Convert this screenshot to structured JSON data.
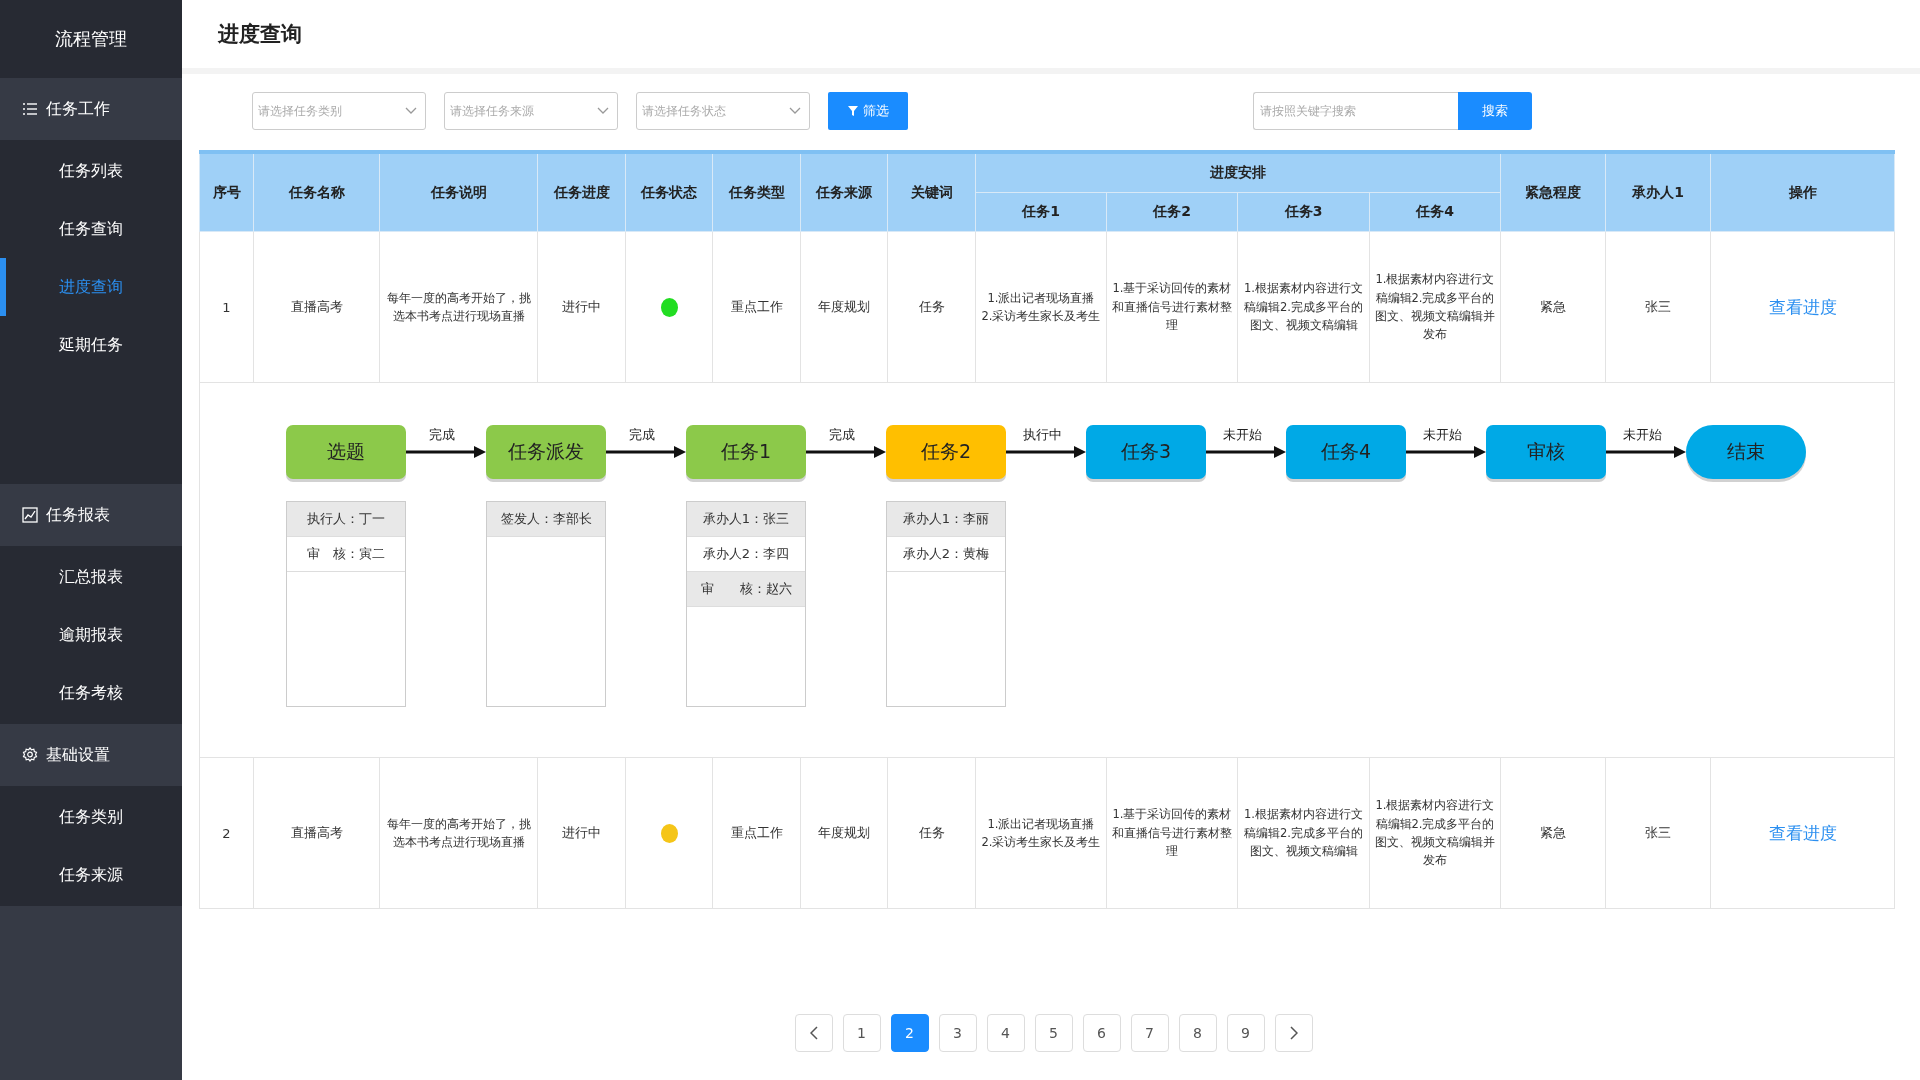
{
  "sidebar": {
    "title": "流程管理",
    "groups": [
      {
        "label": "任务工作",
        "items": [
          {
            "label": "任务列表",
            "selected": false
          },
          {
            "label": "任务查询",
            "selected": false
          },
          {
            "label": "进度查询",
            "selected": true
          },
          {
            "label": "延期任务",
            "selected": false
          }
        ]
      },
      {
        "label": "任务报表",
        "items": [
          {
            "label": "汇总报表",
            "selected": false
          },
          {
            "label": "逾期报表",
            "selected": false
          },
          {
            "label": "任务考核",
            "selected": false
          }
        ]
      },
      {
        "label": "基础设置",
        "items": [
          {
            "label": "任务类别",
            "selected": false
          },
          {
            "label": "任务来源",
            "selected": false
          }
        ]
      }
    ]
  },
  "page_title": "进度查询",
  "filters": [
    {
      "placeholder": "请选择任务类别"
    },
    {
      "placeholder": "请选择任务来源"
    },
    {
      "placeholder": "请选择任务状态"
    }
  ],
  "filter_button": "筛选",
  "search": {
    "placeholder": "请按照关键字搜索",
    "button": "搜索"
  },
  "table": {
    "columns_before": [
      "序号",
      "任务名称",
      "任务说明",
      "任务进度",
      "任务状态",
      "任务类型",
      "任务来源",
      "关键词"
    ],
    "group": {
      "label": "进度安排",
      "columns": [
        "任务1",
        "任务2",
        "任务3",
        "任务4"
      ]
    },
    "columns_after": [
      "紧急程度",
      "承办人1",
      "操作"
    ],
    "rows": [
      {
        "index": "1",
        "name": "直播高考",
        "description": "每年一度的高考开始了，挑选本书考点进行现场直播",
        "progress": "进行中",
        "color": "#22dd22",
        "type": "重点工作",
        "source": "年度规划",
        "keyword": "任务",
        "tasks": [
          "1.派出记者现场直播\n2.采访考生家长及考生",
          "1.基于采访回传的素材和直播信号进行素材整理",
          "1.根据素材内容进行文稿编辑2.完成多平台的图文、视频文稿编辑",
          "1.根据素材内容进行文稿编辑2.完成多平台的图文、视频文稿编辑并发布"
        ],
        "urgency": "紧急",
        "assignee": "张三",
        "action": "查看进度",
        "flow": [
          {
            "label": "选题",
            "kind": "done",
            "edge_label": "完成",
            "details": [
              "执行人：丁一",
              "审　核：寅二"
            ]
          },
          {
            "label": "任务派发",
            "kind": "done",
            "edge_label": "完成",
            "details": [
              "签发人：李部长"
            ]
          },
          {
            "label": "任务1",
            "kind": "done",
            "edge_label": "完成",
            "details": [
              "承办人1：张三",
              "承办人2：李四",
              "审　　核：赵六"
            ]
          },
          {
            "label": "任务2",
            "kind": "doing",
            "edge_label": "执行中",
            "details": [
              "承办人1：李丽",
              "承办人2：黄梅"
            ]
          },
          {
            "label": "任务3",
            "kind": "todo",
            "edge_label": "未开始"
          },
          {
            "label": "任务4",
            "kind": "todo",
            "edge_label": "未开始"
          },
          {
            "label": "审核",
            "kind": "todo",
            "edge_label": "未开始"
          },
          {
            "label": "结束",
            "kind": "end"
          }
        ]
      },
      {
        "index": "2",
        "name": "直播高考",
        "description": "每年一度的高考开始了，挑选本书考点进行现场直播",
        "progress": "进行中",
        "color": "#f5c518",
        "type": "重点工作",
        "source": "年度规划",
        "keyword": "任务",
        "tasks": [
          "1.派出记者现场直播\n2.采访考生家长及考生",
          "1.基于采访回传的素材和直播信号进行素材整理",
          "1.根据素材内容进行文稿编辑2.完成多平台的图文、视频文稿编辑",
          "1.根据素材内容进行文稿编辑2.完成多平台的图文、视频文稿编辑并发布"
        ],
        "urgency": "紧急",
        "assignee": "张三",
        "action": "查看进度"
      }
    ]
  },
  "pagination": {
    "pages": [
      {
        "label": "1",
        "selected": false
      },
      {
        "label": "2",
        "selected": true
      },
      {
        "label": "3",
        "selected": false
      },
      {
        "label": "4",
        "selected": false
      },
      {
        "label": "5",
        "selected": false
      },
      {
        "label": "6",
        "selected": false
      },
      {
        "label": "7",
        "selected": false
      },
      {
        "label": "8",
        "selected": false
      },
      {
        "label": "9",
        "selected": false
      }
    ]
  }
}
